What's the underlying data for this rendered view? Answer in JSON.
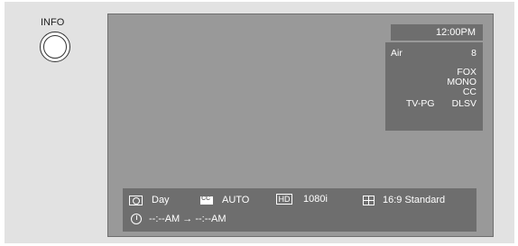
{
  "info_label": "INFO",
  "clock": "12:00PM",
  "channel": {
    "source": "Air",
    "number": "8",
    "network": "FOX",
    "audio": "MONO",
    "captions": "CC",
    "rating": "TV-PG",
    "rating_flags": "DLSV"
  },
  "status_bar": {
    "picture_mode": "Day",
    "cc_mode": "AUTO",
    "resolution": "1080i",
    "aspect": "16:9 Standard",
    "timer_sub": "",
    "timer_range": "--:--AM → --:--AM"
  },
  "icons": {
    "picture_mode": "picture-mode-icon",
    "cc": "closed-caption-icon",
    "hd": "hd-icon",
    "aspect": "aspect-ratio-icon",
    "timer": "timer-icon"
  },
  "hd_badge": "HD"
}
